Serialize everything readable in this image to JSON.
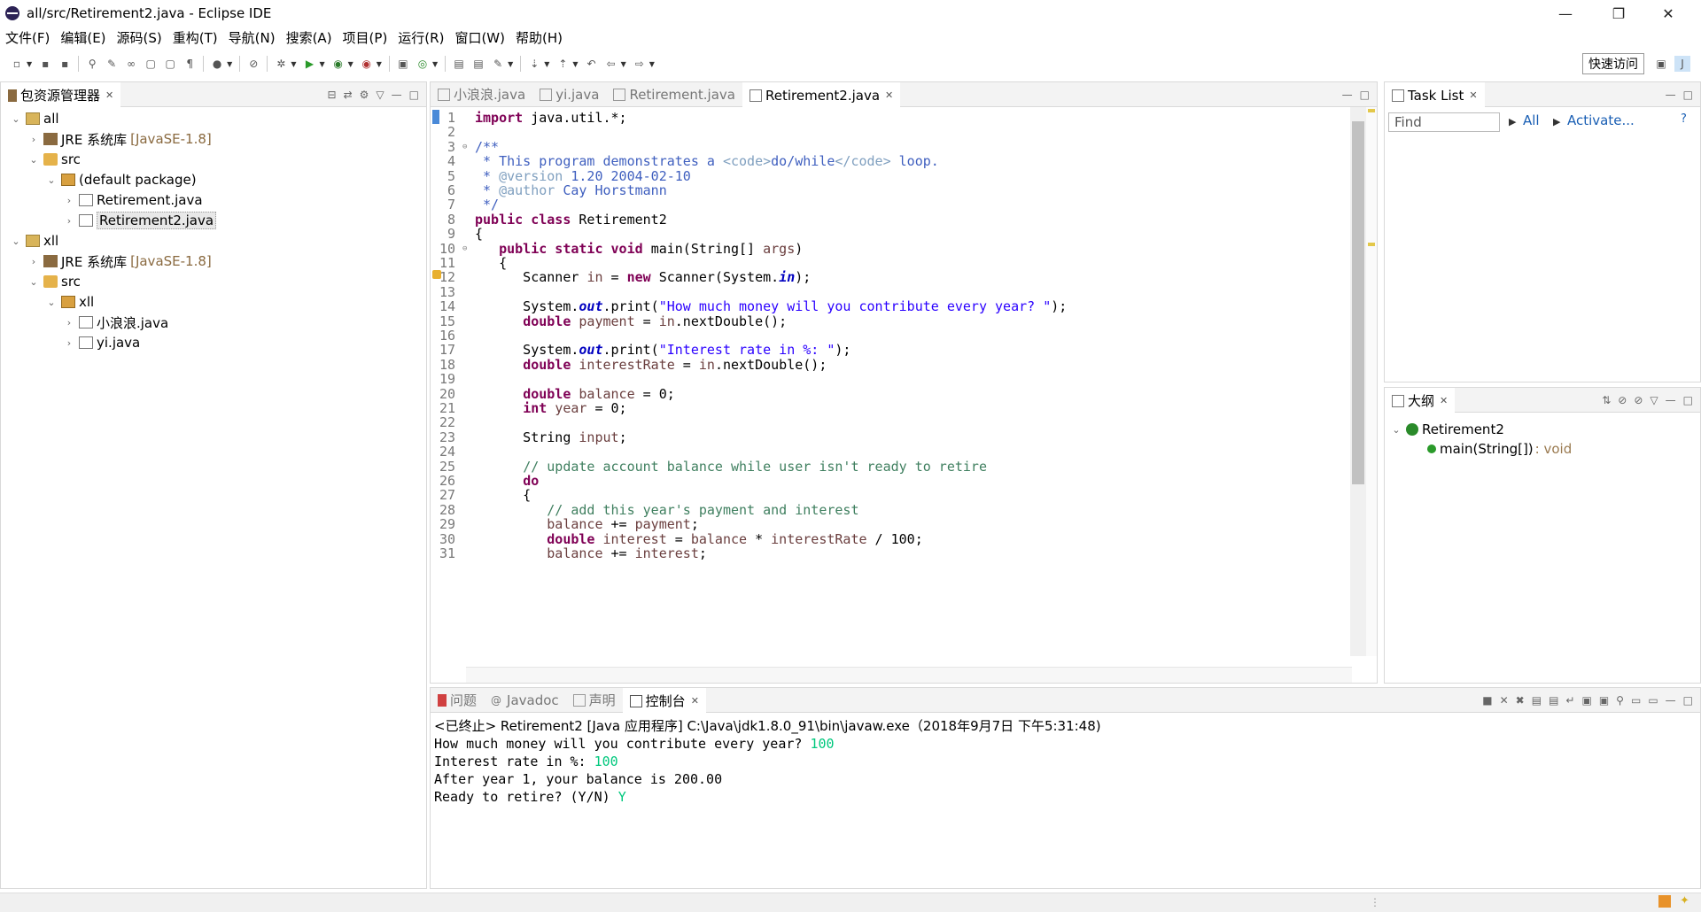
{
  "window": {
    "title": "all/src/Retirement2.java - Eclipse IDE",
    "minimize": "—",
    "restore": "❐",
    "close": "✕"
  },
  "menus": [
    "文件(F)",
    "编辑(E)",
    "源码(S)",
    "重构(T)",
    "导航(N)",
    "搜索(A)",
    "项目(P)",
    "运行(R)",
    "窗口(W)",
    "帮助(H)"
  ],
  "toolbar": {
    "quick_access": "快速访问"
  },
  "package_explorer": {
    "tab_label": "包资源管理器",
    "tree": [
      {
        "label": "all",
        "indent": 0,
        "arrow": "⌄",
        "icon": "project"
      },
      {
        "label": "JRE 系统库",
        "suffix": "[JavaSE-1.8]",
        "indent": 1,
        "arrow": "›",
        "icon": "library"
      },
      {
        "label": "src",
        "indent": 1,
        "arrow": "⌄",
        "icon": "source-folder"
      },
      {
        "label": "(default package)",
        "indent": 2,
        "arrow": "⌄",
        "icon": "package"
      },
      {
        "label": "Retirement.java",
        "indent": 3,
        "arrow": "›",
        "icon": "java-file"
      },
      {
        "label": "Retirement2.java",
        "indent": 3,
        "arrow": "›",
        "icon": "java-file",
        "selected": true
      },
      {
        "label": "xll",
        "indent": 0,
        "arrow": "⌄",
        "icon": "project"
      },
      {
        "label": "JRE 系统库",
        "suffix": "[JavaSE-1.8]",
        "indent": 1,
        "arrow": "›",
        "icon": "library"
      },
      {
        "label": "src",
        "indent": 1,
        "arrow": "⌄",
        "icon": "source-folder"
      },
      {
        "label": "xll",
        "indent": 2,
        "arrow": "⌄",
        "icon": "package"
      },
      {
        "label": "小浪浪.java",
        "indent": 3,
        "arrow": "›",
        "icon": "java-file"
      },
      {
        "label": "yi.java",
        "indent": 3,
        "arrow": "›",
        "icon": "java-file"
      }
    ]
  },
  "editor": {
    "tabs": [
      {
        "label": "小浪浪.java",
        "active": false
      },
      {
        "label": "yi.java",
        "active": false
      },
      {
        "label": "Retirement.java",
        "active": false
      },
      {
        "label": "Retirement2.java",
        "active": true
      }
    ],
    "lines": [
      [
        {
          "t": "import ",
          "c": "kw"
        },
        {
          "t": "java.util.*;"
        }
      ],
      [],
      [
        {
          "t": "/**",
          "c": "jd"
        }
      ],
      [
        {
          "t": " * This program demonstrates a ",
          "c": "jd"
        },
        {
          "t": "<code>",
          "c": "jdt"
        },
        {
          "t": "do/while",
          "c": "jd"
        },
        {
          "t": "</code>",
          "c": "jdt"
        },
        {
          "t": " loop.",
          "c": "jd"
        }
      ],
      [
        {
          "t": " * ",
          "c": "jd"
        },
        {
          "t": "@version",
          "c": "jdt"
        },
        {
          "t": " 1.20 2004-02-10",
          "c": "jd"
        }
      ],
      [
        {
          "t": " * ",
          "c": "jd"
        },
        {
          "t": "@author",
          "c": "jdt"
        },
        {
          "t": " Cay Horstmann",
          "c": "jd"
        }
      ],
      [
        {
          "t": " */",
          "c": "jd"
        }
      ],
      [
        {
          "t": "public class ",
          "c": "kw"
        },
        {
          "t": "Retirement2"
        }
      ],
      [
        {
          "t": "{"
        }
      ],
      [
        {
          "t": "   "
        },
        {
          "t": "public static void ",
          "c": "kw"
        },
        {
          "t": "main(String[] "
        },
        {
          "t": "args",
          "c": "vr"
        },
        {
          "t": ")"
        }
      ],
      [
        {
          "t": "   {"
        }
      ],
      [
        {
          "t": "      Scanner "
        },
        {
          "t": "in",
          "c": "vr"
        },
        {
          "t": " = "
        },
        {
          "t": "new ",
          "c": "kw"
        },
        {
          "t": "Scanner(System."
        },
        {
          "t": "in",
          "c": "fld"
        },
        {
          "t": ");"
        }
      ],
      [],
      [
        {
          "t": "      System."
        },
        {
          "t": "out",
          "c": "fld"
        },
        {
          "t": ".print("
        },
        {
          "t": "\"How much money will you contribute every year? \"",
          "c": "str"
        },
        {
          "t": ");"
        }
      ],
      [
        {
          "t": "      "
        },
        {
          "t": "double ",
          "c": "kw"
        },
        {
          "t": "payment",
          "c": "vr"
        },
        {
          "t": " = "
        },
        {
          "t": "in",
          "c": "vr"
        },
        {
          "t": ".nextDouble();"
        }
      ],
      [],
      [
        {
          "t": "      System."
        },
        {
          "t": "out",
          "c": "fld"
        },
        {
          "t": ".print("
        },
        {
          "t": "\"Interest rate in %: \"",
          "c": "str"
        },
        {
          "t": ");"
        }
      ],
      [
        {
          "t": "      "
        },
        {
          "t": "double ",
          "c": "kw"
        },
        {
          "t": "interestRate",
          "c": "vr"
        },
        {
          "t": " = "
        },
        {
          "t": "in",
          "c": "vr"
        },
        {
          "t": ".nextDouble();"
        }
      ],
      [],
      [
        {
          "t": "      "
        },
        {
          "t": "double ",
          "c": "kw"
        },
        {
          "t": "balance",
          "c": "vr"
        },
        {
          "t": " = 0;"
        }
      ],
      [
        {
          "t": "      "
        },
        {
          "t": "int ",
          "c": "kw"
        },
        {
          "t": "year",
          "c": "vr"
        },
        {
          "t": " = 0;"
        }
      ],
      [],
      [
        {
          "t": "      String "
        },
        {
          "t": "input",
          "c": "vr"
        },
        {
          "t": ";"
        }
      ],
      [],
      [
        {
          "t": "      "
        },
        {
          "t": "// update account balance while user isn't ready to retire",
          "c": "cm"
        }
      ],
      [
        {
          "t": "      "
        },
        {
          "t": "do",
          "c": "kw"
        }
      ],
      [
        {
          "t": "      {"
        }
      ],
      [
        {
          "t": "         "
        },
        {
          "t": "// add this year's payment and interest",
          "c": "cm"
        }
      ],
      [
        {
          "t": "         "
        },
        {
          "t": "balance",
          "c": "vr"
        },
        {
          "t": " += "
        },
        {
          "t": "payment",
          "c": "vr"
        },
        {
          "t": ";"
        }
      ],
      [
        {
          "t": "         "
        },
        {
          "t": "double ",
          "c": "kw"
        },
        {
          "t": "interest",
          "c": "vr"
        },
        {
          "t": " = "
        },
        {
          "t": "balance",
          "c": "vr"
        },
        {
          "t": " * "
        },
        {
          "t": "interestRate",
          "c": "vr"
        },
        {
          "t": " / 100;"
        }
      ],
      [
        {
          "t": "         "
        },
        {
          "t": "balance",
          "c": "vr"
        },
        {
          "t": " += "
        },
        {
          "t": "interest",
          "c": "vr"
        },
        {
          "t": ";"
        }
      ]
    ]
  },
  "task_list": {
    "tab_label": "Task List",
    "find_placeholder": "Find",
    "all_label": "All",
    "activate_label": "Activate..."
  },
  "outline": {
    "tab_label": "大纲",
    "class_name": "Retirement2",
    "method": "main(String[])",
    "method_type": ": void"
  },
  "console": {
    "tabs": [
      {
        "label": "问题",
        "active": false
      },
      {
        "label": "Javadoc",
        "active": false
      },
      {
        "label": "声明",
        "active": false
      },
      {
        "label": "控制台",
        "active": true
      }
    ],
    "status": "<已终止> Retirement2 [Java 应用程序] C:\\Java\\jdk1.8.0_91\\bin\\javaw.exe（2018年9月7日 下午5:31:48)",
    "lines": [
      {
        "out": "How much money will you contribute every year? ",
        "in": "100"
      },
      {
        "out": "Interest rate in %: ",
        "in": "100"
      },
      {
        "out": "After year 1, your balance is 200.00",
        "in": ""
      },
      {
        "out": "Ready to retire? (Y/N) ",
        "in": "Y"
      }
    ]
  }
}
